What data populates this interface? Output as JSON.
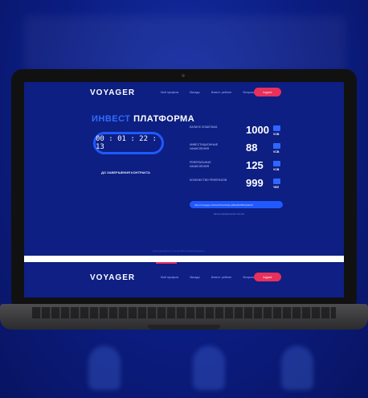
{
  "nav": {
    "logo": "VOYAGER",
    "links": [
      "Мой профиль",
      "Вклады",
      "Инвест. рейтинг",
      "Вопросы и ответы"
    ],
    "logout": "logout"
  },
  "hero": {
    "title_accent": "ИНВЕСТ",
    "title_rest": "ПЛАТФОРМА",
    "timer": "00 : 01 : 22 : 13",
    "timer_caption": "ДО ЗАВЕРШЕНИЯ КОНТРАКТА"
  },
  "stats": [
    {
      "label": "БАЛАНС КОШЕЛЬКА",
      "value": "1000",
      "unit": "VCB"
    },
    {
      "label": "ИНВЕСТИЦИОННЫЕ НАЧИСЛЕНИЯ",
      "value": "88",
      "unit": "VCB"
    },
    {
      "label": "РЕФЕРАЛЬНЫЕ НАЧИСЛЕНИЯ",
      "value": "125",
      "unit": "VCB"
    },
    {
      "label": "КОЛИЧЕСТВО РЕФЕРАЛОВ",
      "value": "999",
      "unit": "ЧЕЛ"
    }
  ],
  "referral": {
    "url": "https://voyager.club/ref/rFHc22Qou2fEd2030f9c3d4e6f",
    "note": "ваша реферальная ссылка"
  },
  "footer": {
    "text": "регистрируйтесь и получайте вознаграждения"
  }
}
